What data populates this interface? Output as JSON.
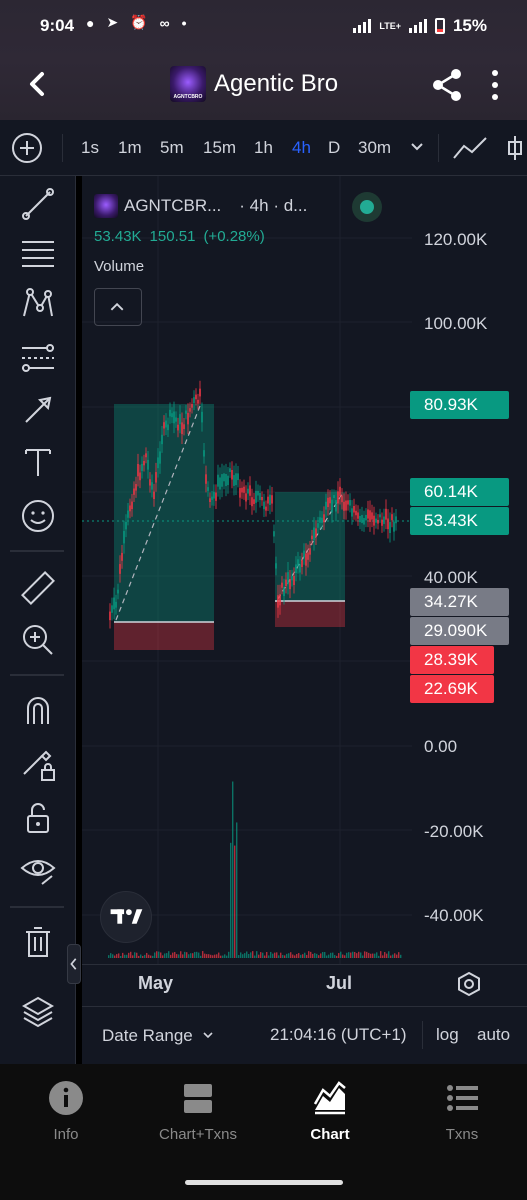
{
  "status_bar": {
    "time": "9:04",
    "battery_percent": "15%",
    "network": "LTE+"
  },
  "header": {
    "logo_text": "AGNTCBRO",
    "title": "Agentic Bro"
  },
  "toolbar": {
    "timeframes": [
      "1s",
      "1m",
      "5m",
      "15m",
      "1h",
      "4h",
      "D",
      "30m"
    ],
    "active_timeframe": "4h"
  },
  "legend": {
    "symbol": "AGNTCBR...",
    "interval": "· 4h · d...",
    "last_value": "53.43K",
    "change": "150.51",
    "change_pct": "(+0.28%)",
    "volume_label": "Volume"
  },
  "price_axis": {
    "labels": [
      "120.00K",
      "100.00K",
      "40.00K",
      "0.00",
      "-20.00K",
      "-40.00K"
    ]
  },
  "price_tags": [
    {
      "label": "80.93K",
      "color": "#089981"
    },
    {
      "label": "60.14K",
      "color": "#089981"
    },
    {
      "label": "53.43K",
      "color": "#089981"
    },
    {
      "label": "34.27K",
      "color": "#787b86"
    },
    {
      "label": "29.090K",
      "color": "#787b86"
    },
    {
      "label": "28.39K",
      "color": "#f23645"
    },
    {
      "label": "22.69K",
      "color": "#f23645"
    }
  ],
  "time_axis": {
    "labels": [
      "May",
      "Jul"
    ]
  },
  "bottom_controls": {
    "date_range_label": "Date Range",
    "clock": "21:04:16 (UTC+1)",
    "log_label": "log",
    "auto_label": "auto"
  },
  "bottom_nav": {
    "items": [
      {
        "label": "Info"
      },
      {
        "label": "Chart+Txns"
      },
      {
        "label": "Chart"
      },
      {
        "label": "Txns"
      }
    ],
    "active": "Chart"
  },
  "colors": {
    "up": "#089981",
    "down": "#f23645",
    "accent": "#2962ff",
    "background": "#131722"
  }
}
